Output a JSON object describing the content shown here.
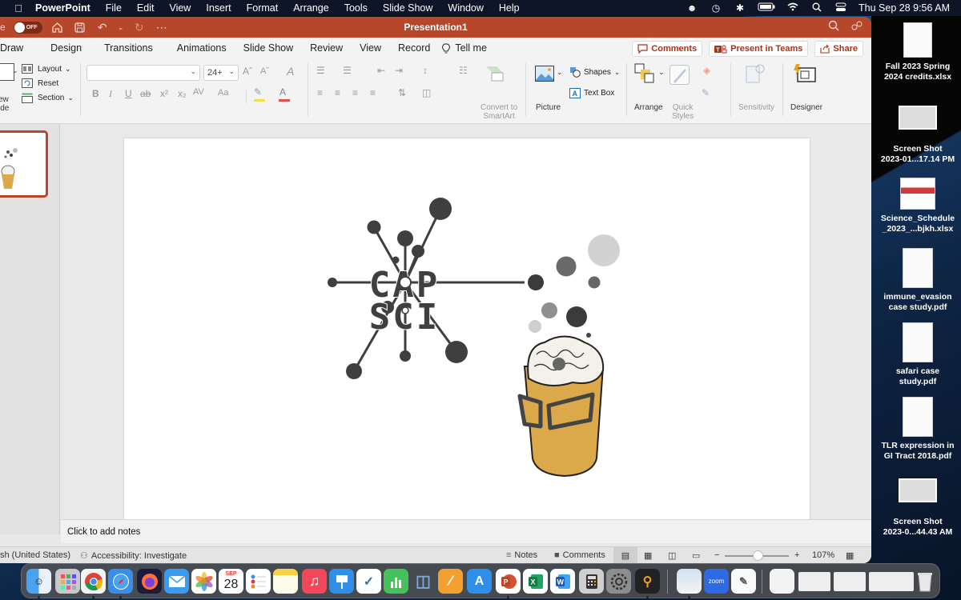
{
  "menubar": {
    "apple_icon": "apple-logo",
    "app_name": "PowerPoint",
    "items": [
      "File",
      "Edit",
      "View",
      "Insert",
      "Format",
      "Arrange",
      "Tools",
      "Slide Show",
      "Window",
      "Help"
    ],
    "status_icons": [
      "user-alert-icon",
      "time-machine-icon",
      "bluetooth-icon",
      "battery-charging-icon",
      "wifi-icon",
      "spotlight-search-icon",
      "control-center-icon"
    ],
    "clock": "Thu Sep 28  9:56 AM"
  },
  "titlebar": {
    "autosave_prefix": "e",
    "autosave_state": "OFF",
    "title": "Presentation1",
    "icons": [
      "home-icon",
      "save-icon",
      "undo-icon",
      "redo-icon",
      "more-icon"
    ],
    "right_icons": [
      "search-icon",
      "share-people-icon"
    ]
  },
  "tabs": [
    "Draw",
    "Design",
    "Transitions",
    "Animations",
    "Slide Show",
    "Review",
    "View",
    "Record"
  ],
  "tell_me": "Tell me",
  "header_buttons": {
    "comments": "Comments",
    "present": "Present in Teams",
    "share": "Share"
  },
  "ribbon": {
    "slides": {
      "new_slide_partial": [
        "ew",
        "ide"
      ],
      "layout": "Layout",
      "reset": "Reset",
      "section": "Section"
    },
    "font": {
      "font_name": "",
      "font_size": "24+",
      "grow": "Aˆ",
      "shrink": "Aˇ",
      "clear": "A",
      "bold": "B",
      "italic": "I",
      "underline": "U",
      "strike": "ab",
      "superscript": "x²",
      "subscript": "x₂",
      "spacing": "AV",
      "case": "Aa",
      "highlight_color": "#f0e04a",
      "font_color": "#e05050"
    },
    "paragraph": {
      "convert_label": "Convert to SmartArt",
      "convert_l1": "Convert to",
      "convert_l2": "SmartArt"
    },
    "insert": {
      "picture": "Picture",
      "shapes": "Shapes",
      "text_box": "Text Box"
    },
    "drawing": {
      "arrange": "Arrange",
      "quick_styles_l1": "Quick",
      "quick_styles_l2": "Styles"
    },
    "sensitivity": "Sensitivity",
    "designer": "Designer"
  },
  "slide": {
    "logo_line1": "CAP",
    "logo_line2": "SCI",
    "logo_color": "#3f3f3f",
    "cup_color": "#dba949"
  },
  "notes_placeholder": "Click to add notes",
  "statusbar": {
    "language": "sh (United States)",
    "accessibility": "Accessibility: Investigate",
    "notes": "Notes",
    "comments": "Comments",
    "zoom_percent": "107%",
    "zoom_level": 107
  },
  "desktop_files": [
    {
      "line1": "Fall 2023 Spring",
      "line2": "2024 credits.xlsx",
      "type": "xlsx"
    },
    {
      "line1": "Screen Shot",
      "line2": "2023-01...17.14 PM",
      "type": "screenshot"
    },
    {
      "line1": "Science_Schedule",
      "line2": "_2023_...bjkh.xlsx",
      "type": "xlsx"
    },
    {
      "line1": "immune_evasion",
      "line2": "case study.pdf",
      "type": "pdf"
    },
    {
      "line1": "safari case",
      "line2": "study.pdf",
      "type": "pdf"
    },
    {
      "line1": "TLR expression in",
      "line2": "GI Tract 2018.pdf",
      "type": "pdf"
    },
    {
      "line1": "Screen Shot",
      "line2": "2023-0...44.43 AM",
      "type": "screenshot"
    }
  ],
  "dock": {
    "calendar_month": "SEP",
    "calendar_day": "28",
    "zoom_label": "zoom",
    "apps": [
      "Finder",
      "Launchpad",
      "Chrome",
      "Safari",
      "Firefox",
      "Mail",
      "Photos",
      "Calendar",
      "Reminders",
      "Notes",
      "Music",
      "Keynote",
      "Freeform",
      "Numbers",
      "Mirror",
      "Pages",
      "App Store",
      "PowerPoint",
      "Excel",
      "Word",
      "Calculator",
      "System Settings",
      "Keychain Access",
      "Preview",
      "Zoom",
      "TextEdit",
      "Downloads",
      "Screenshot 1",
      "Screenshot 2",
      "Screenshot 3",
      "Screenshot 4",
      "Trash"
    ]
  }
}
